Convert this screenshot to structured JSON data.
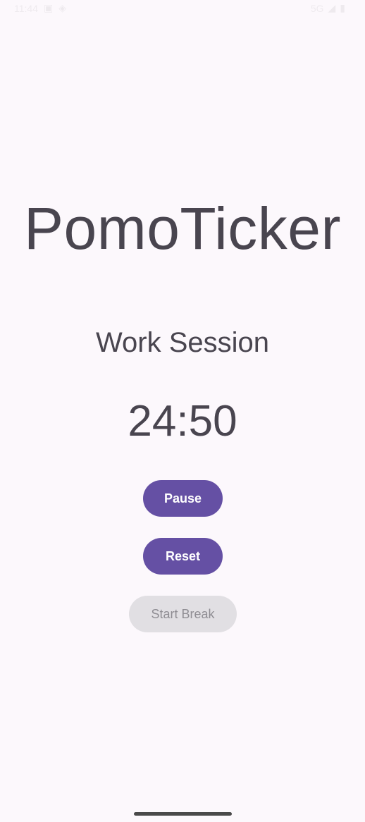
{
  "status_bar": {
    "time": "11:44",
    "network": "5G"
  },
  "app": {
    "title": "PomoTicker"
  },
  "session": {
    "label": "Work Session"
  },
  "timer": {
    "display": "24:50"
  },
  "buttons": {
    "pause": "Pause",
    "reset": "Reset",
    "start_break": "Start Break"
  },
  "colors": {
    "background": "#fcf8fc",
    "primary": "#6550a4",
    "text": "#49454f",
    "disabled_bg": "#e1dfe3",
    "disabled_text": "#8f8d93"
  }
}
